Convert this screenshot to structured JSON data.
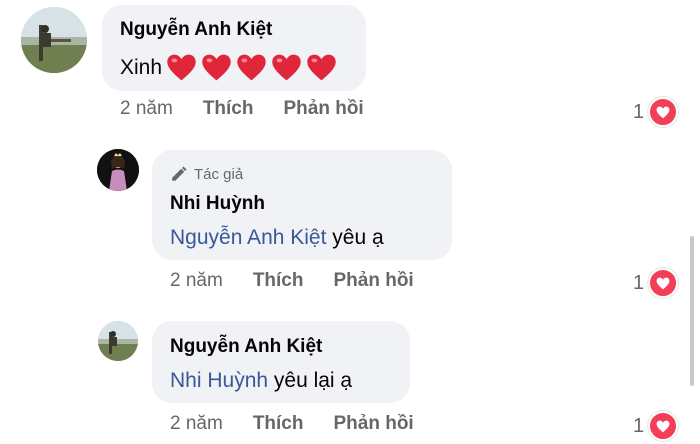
{
  "comments": [
    {
      "author": "Nguyễn Anh Kiệt",
      "text": "Xinh",
      "hearts": 5,
      "time": "2 năm",
      "like_label": "Thích",
      "reply_label": "Phản hồi",
      "reaction_count": "1",
      "reaction": "love-icon"
    },
    {
      "badge": "Tác giả",
      "author": "Nhi Huỳnh",
      "mention": "Nguyễn Anh Kiệt",
      "text": " yêu ạ",
      "time": "2 năm",
      "like_label": "Thích",
      "reply_label": "Phản hồi",
      "reaction_count": "1",
      "reaction": "love-icon"
    },
    {
      "author": "Nguyễn Anh Kiệt",
      "mention": "Nhi Huỳnh",
      "text": " yêu lại ạ",
      "time": "2 năm",
      "like_label": "Thích",
      "reply_label": "Phản hồi",
      "reaction_count": "1",
      "reaction": "love-icon"
    }
  ],
  "colors": {
    "bubble": "#f0f2f5",
    "mention": "#385898",
    "muted": "#65676b",
    "love": "#f33e58",
    "heart": "#e0263b"
  }
}
